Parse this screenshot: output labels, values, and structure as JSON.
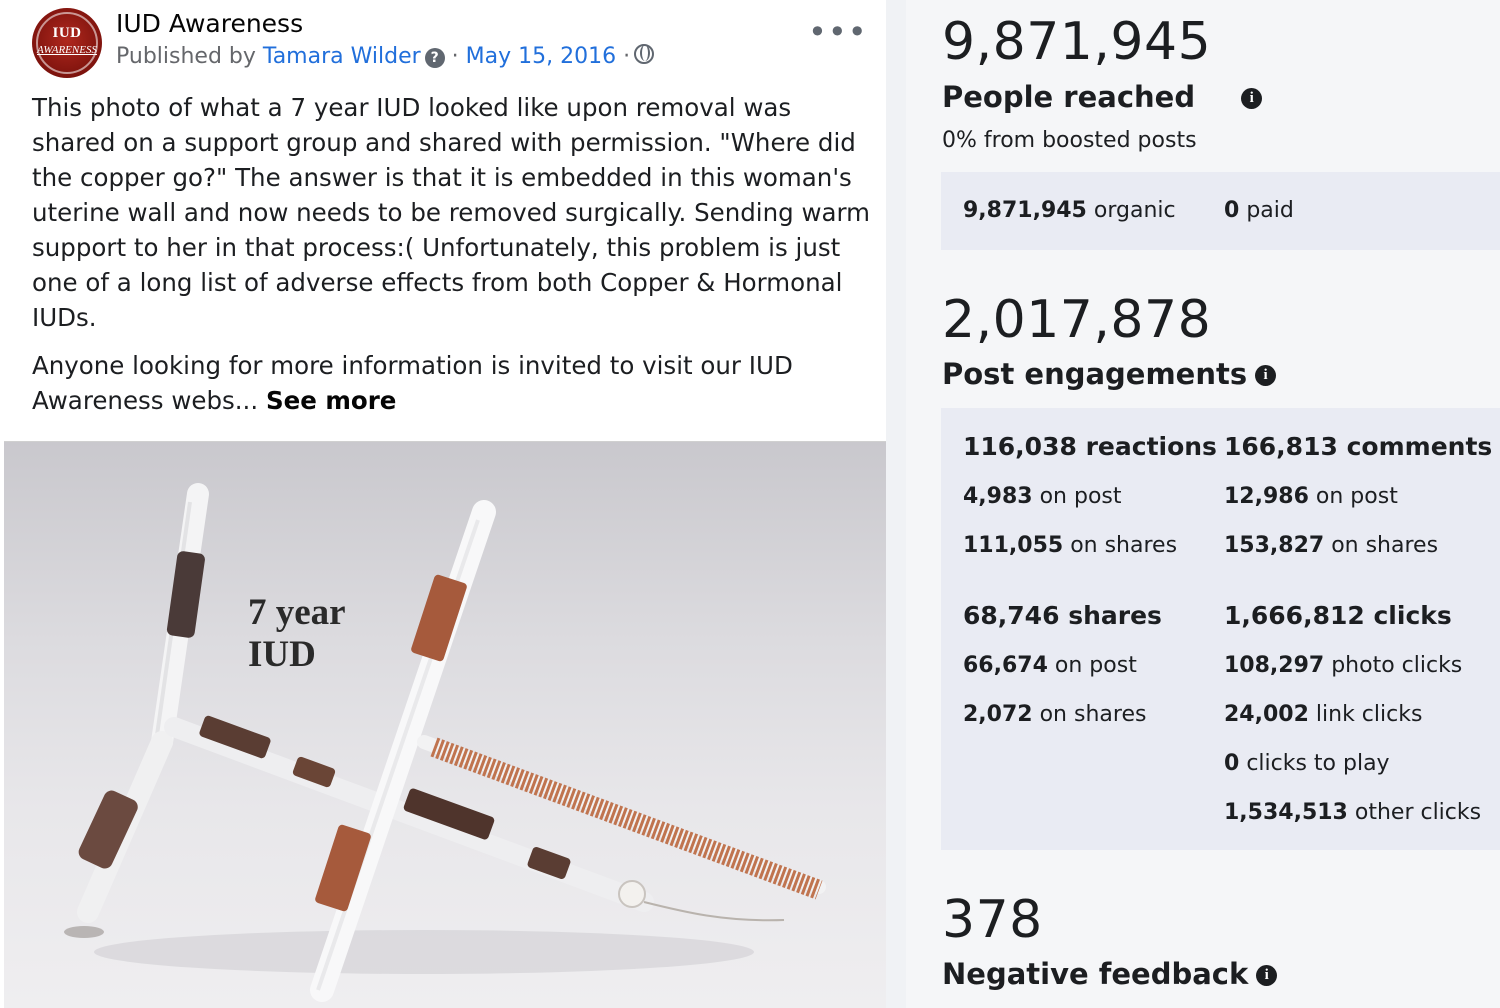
{
  "post": {
    "avatar_text_top": "IUD",
    "avatar_text_bottom": "AWARENESS",
    "page_name": "IUD Awareness",
    "published_by_prefix": "Published by",
    "author": "Tamara Wilder",
    "separator": "·",
    "date": "May 15, 2016",
    "paragraph1": "This photo of what a 7 year IUD looked like upon removal was shared on a support group and shared with permission.  \"Where did the copper go?\" The answer is that it is embedded in this woman's uterine wall and now needs to be removed surgically.  Sending warm support to her in that process:( Unfortunately, this problem is just one of a long list of adverse effects from both Copper & Hormonal IUDs.",
    "paragraph2": "Anyone looking for more information is invited to visit our IUD Awareness webs...",
    "see_more": "See more",
    "photo_label_line1": "7 year",
    "photo_label_line2": "IUD"
  },
  "insights": {
    "reach": {
      "value": "9,871,945",
      "title": "People reached",
      "subtext": "0% from boosted posts",
      "organic_value": "9,871,945",
      "organic_label": "organic",
      "paid_value": "0",
      "paid_label": "paid"
    },
    "engagement": {
      "value": "2,017,878",
      "title": "Post engagements",
      "reactions": {
        "value": "116,038",
        "label": "reactions"
      },
      "reactions_on_post": {
        "value": "4,983",
        "label": "on post"
      },
      "reactions_on_shares": {
        "value": "111,055",
        "label": "on shares"
      },
      "comments": {
        "value": "166,813",
        "label": "comments"
      },
      "comments_on_post": {
        "value": "12,986",
        "label": "on post"
      },
      "comments_on_shares": {
        "value": "153,827",
        "label": "on shares"
      },
      "shares": {
        "value": "68,746",
        "label": "shares"
      },
      "shares_on_post": {
        "value": "66,674",
        "label": "on post"
      },
      "shares_on_shares": {
        "value": "2,072",
        "label": "on shares"
      },
      "clicks": {
        "value": "1,666,812",
        "label": "clicks"
      },
      "photo_clicks": {
        "value": "108,297",
        "label": "photo clicks"
      },
      "link_clicks": {
        "value": "24,002",
        "label": "link clicks"
      },
      "clicks_to_play": {
        "value": "0",
        "label": "clicks to play"
      },
      "other_clicks": {
        "value": "1,534,513",
        "label": "other clicks"
      }
    },
    "negative": {
      "value": "378",
      "title": "Negative feedback"
    }
  },
  "colors": {
    "link": "#216fdb",
    "metric_box": "#e9ebf3",
    "avatar_red": "#9e1f16",
    "copper": "#b56a4a"
  }
}
